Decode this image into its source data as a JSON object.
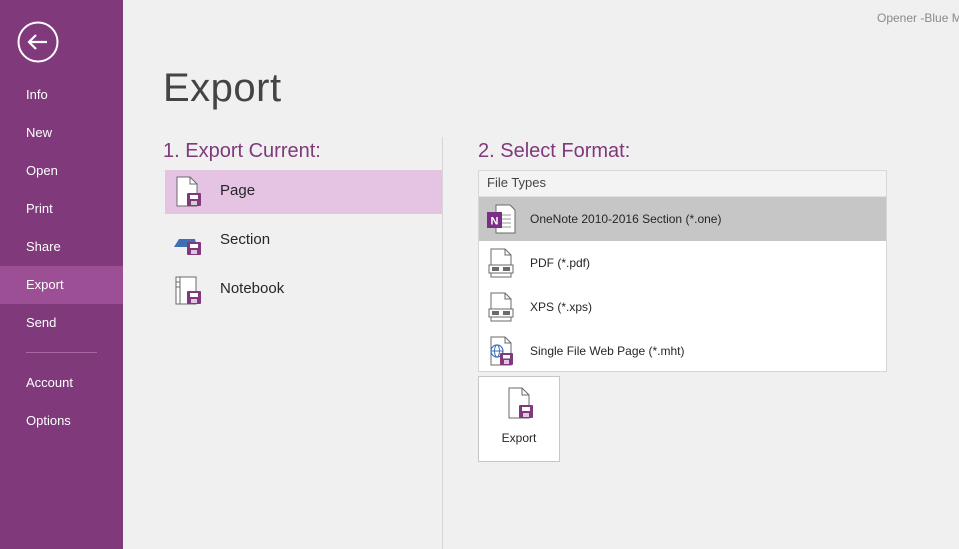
{
  "window": {
    "title": "Opener -Blue M"
  },
  "sidebar": {
    "back_icon": "back-arrow-icon",
    "items": [
      {
        "label": "Info"
      },
      {
        "label": "New"
      },
      {
        "label": "Open"
      },
      {
        "label": "Print"
      },
      {
        "label": "Share"
      },
      {
        "label": "Export",
        "active": true
      },
      {
        "label": "Send"
      },
      {
        "label": "Account"
      },
      {
        "label": "Options"
      }
    ]
  },
  "main": {
    "title": "Export",
    "export_current": {
      "heading": "1. Export Current:",
      "options": [
        {
          "label": "Page",
          "icon": "page-icon",
          "selected": true
        },
        {
          "label": "Section",
          "icon": "section-icon"
        },
        {
          "label": "Notebook",
          "icon": "notebook-icon"
        }
      ]
    },
    "select_format": {
      "heading": "2. Select Format:",
      "file_types_header": "File Types",
      "formats": [
        {
          "label": "OneNote 2010-2016 Section (*.one)",
          "icon": "onenote-icon",
          "selected": true
        },
        {
          "label": "PDF (*.pdf)",
          "icon": "pdf-icon"
        },
        {
          "label": "XPS (*.xps)",
          "icon": "xps-icon"
        },
        {
          "label": "Single File Web Page (*.mht)",
          "icon": "web-page-icon"
        }
      ]
    },
    "export_button": {
      "label": "Export",
      "icon": "save-icon"
    }
  },
  "colors": {
    "accent": "#80397b",
    "sidebar_active": "#9d4f96",
    "selected_option": "#e5c3e2",
    "selected_format": "#c6c6c6"
  }
}
